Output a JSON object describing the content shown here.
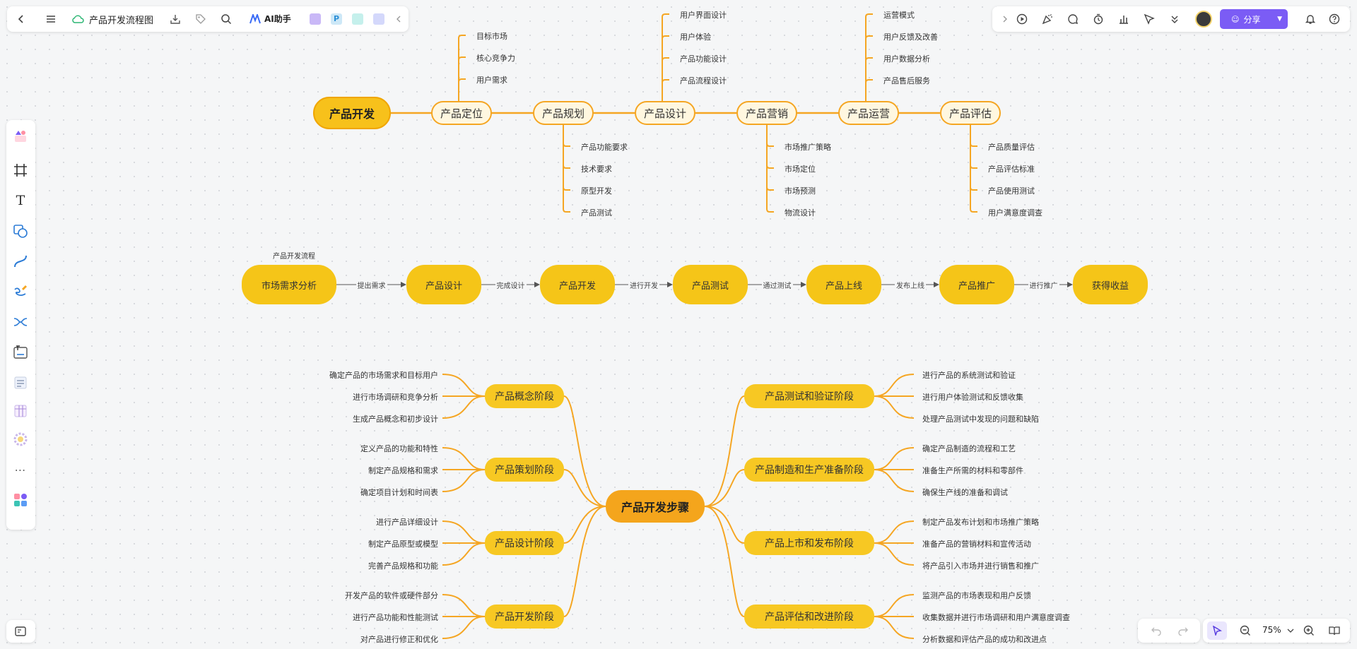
{
  "toolbar": {
    "title": "产品开发流程图",
    "ai_label": "AI助手",
    "share_label": "分享",
    "zoom": "75%"
  },
  "colors": {
    "accent": "#7b5cf5",
    "branch": "#f5a623",
    "node_fill": "#f5c518"
  },
  "mindmap": {
    "root": "产品开发",
    "branches": [
      {
        "label": "产品定位",
        "leaves": [
          "目标市场",
          "核心竞争力",
          "用户需求"
        ],
        "side": "top"
      },
      {
        "label": "产品规划",
        "leaves": [
          "产品功能要求",
          "技术要求",
          "原型开发",
          "产品测试"
        ],
        "side": "bottom"
      },
      {
        "label": "产品设计",
        "leaves": [
          "用户界面设计",
          "用户体验",
          "产品功能设计",
          "产品流程设计"
        ],
        "side": "top"
      },
      {
        "label": "产品营销",
        "leaves": [
          "市场推广策略",
          "市场定位",
          "市场预测",
          "物流设计"
        ],
        "side": "bottom"
      },
      {
        "label": "产品运营",
        "leaves": [
          "运营模式",
          "用户反馈及改善",
          "用户数据分析",
          "产品售后服务"
        ],
        "side": "top"
      },
      {
        "label": "产品评估",
        "leaves": [
          "产品质量评估",
          "产品评估标准",
          "产品使用测试",
          "用户满意度调查"
        ],
        "side": "bottom"
      }
    ]
  },
  "flow": {
    "caption": "产品开发流程",
    "nodes": [
      "市场需求分析",
      "产品设计",
      "产品开发",
      "产品测试",
      "产品上线",
      "产品推广",
      "获得收益"
    ],
    "edges": [
      "提出需求",
      "完成设计",
      "进行开发",
      "通过测试",
      "发布上线",
      "进行推广"
    ]
  },
  "phases": {
    "root": "产品开发步骤",
    "left": [
      {
        "label": "产品概念阶段",
        "items": [
          "确定产品的市场需求和目标用户",
          "进行市场调研和竞争分析",
          "生成产品概念和初步设计"
        ]
      },
      {
        "label": "产品策划阶段",
        "items": [
          "定义产品的功能和特性",
          "制定产品规格和需求",
          "确定项目计划和时间表"
        ]
      },
      {
        "label": "产品设计阶段",
        "items": [
          "进行产品详细设计",
          "制定产品原型或模型",
          "完善产品规格和功能"
        ]
      },
      {
        "label": "产品开发阶段",
        "items": [
          "开发产品的软件或硬件部分",
          "进行产品功能和性能测试",
          "对产品进行修正和优化"
        ]
      }
    ],
    "right": [
      {
        "label": "产品测试和验证阶段",
        "items": [
          "进行产品的系统测试和验证",
          "进行用户体验测试和反馈收集",
          "处理产品测试中发现的问题和缺陷"
        ]
      },
      {
        "label": "产品制造和生产准备阶段",
        "items": [
          "确定产品制造的流程和工艺",
          "准备生产所需的材料和零部件",
          "确保生产线的准备和调试"
        ]
      },
      {
        "label": "产品上市和发布阶段",
        "items": [
          "制定产品发布计划和市场推广策略",
          "准备产品的营销材料和宣传活动",
          "将产品引入市场并进行销售和推广"
        ]
      },
      {
        "label": "产品评估和改进阶段",
        "items": [
          "监测产品的市场表现和用户反馈",
          "收集数据并进行市场调研和用户满意度调查",
          "分析数据和评估产品的成功和改进点"
        ]
      }
    ]
  }
}
